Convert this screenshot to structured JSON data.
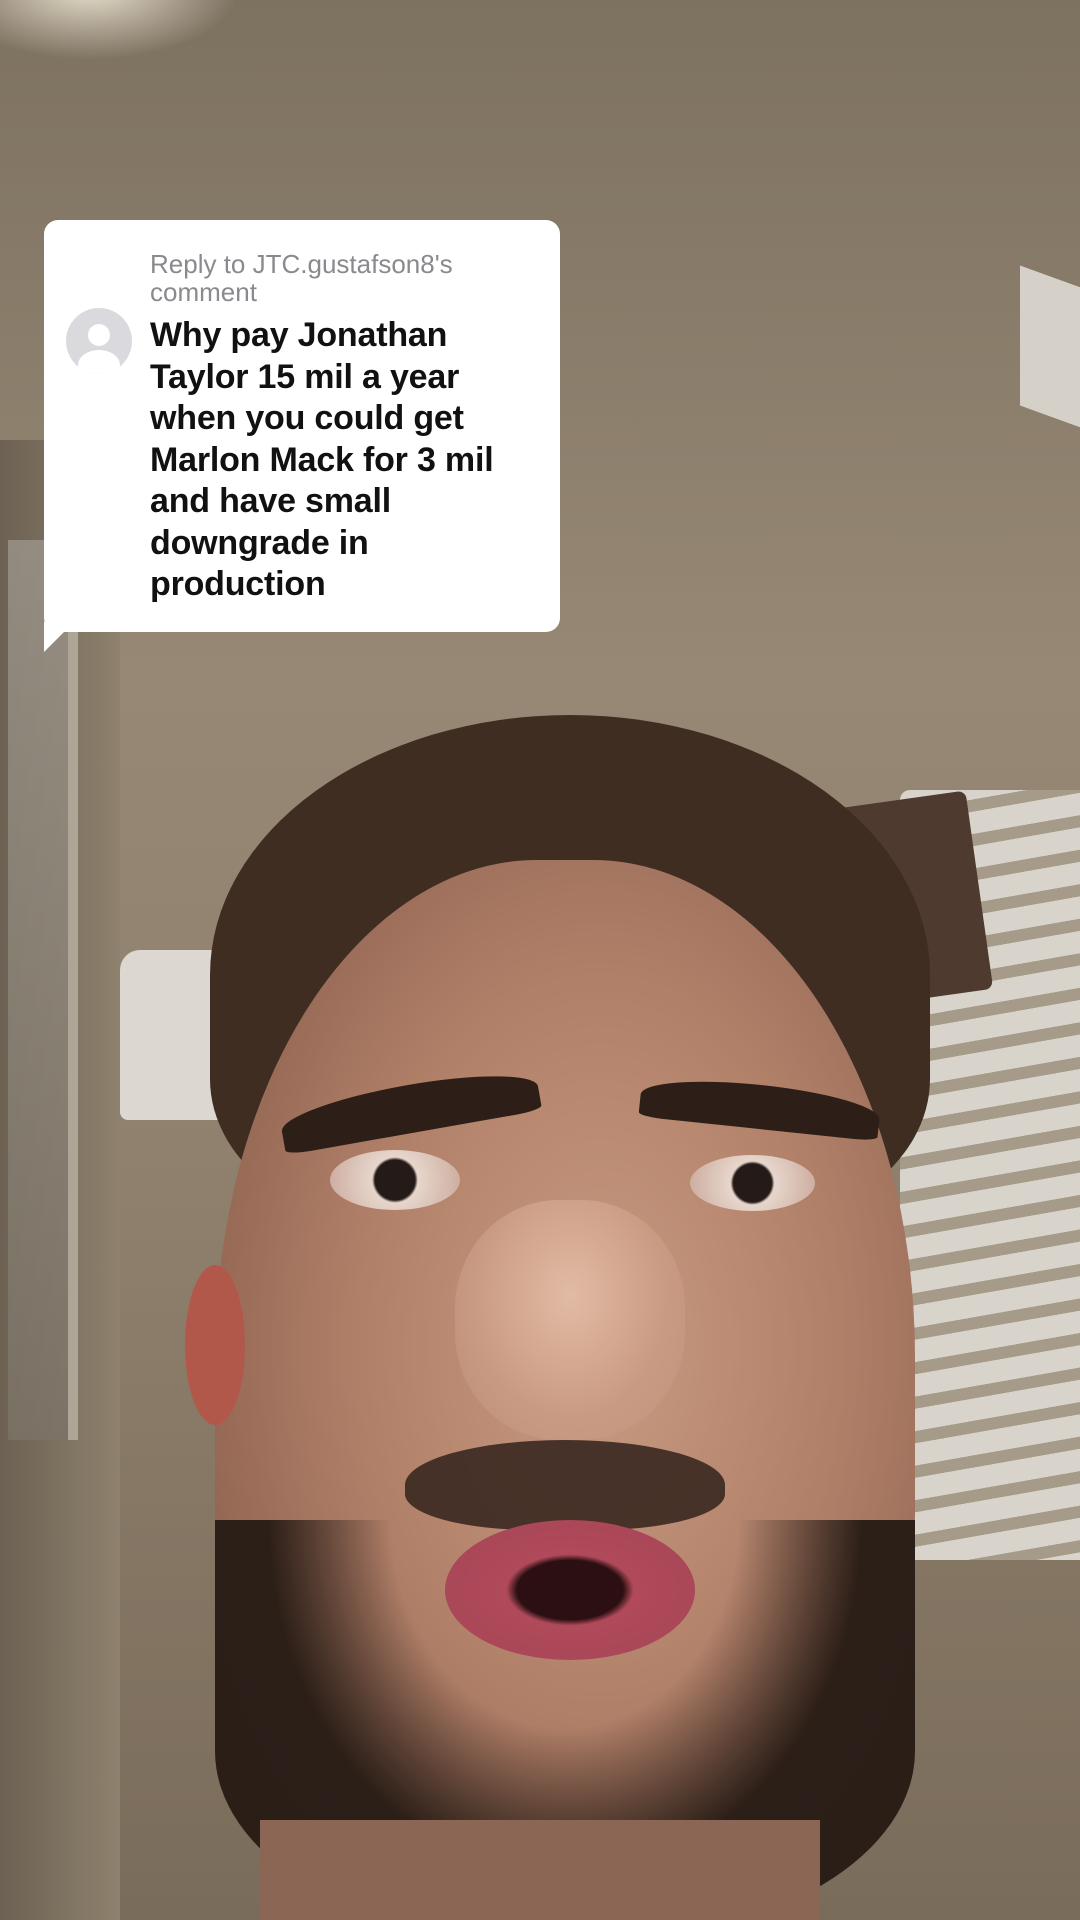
{
  "reply_comment": {
    "label": "Reply to JTC.gustafson8's comment",
    "text": "Why pay Jonathan Taylor 15 mil a year when you could get Marlon Mack for 3 mil and have small downgrade in production",
    "avatar_icon": "default-user-avatar-icon"
  },
  "colors": {
    "card_background": "#ffffff",
    "label_text": "#8a8a8e",
    "body_text": "#111111",
    "avatar_background": "#d9d9de"
  }
}
